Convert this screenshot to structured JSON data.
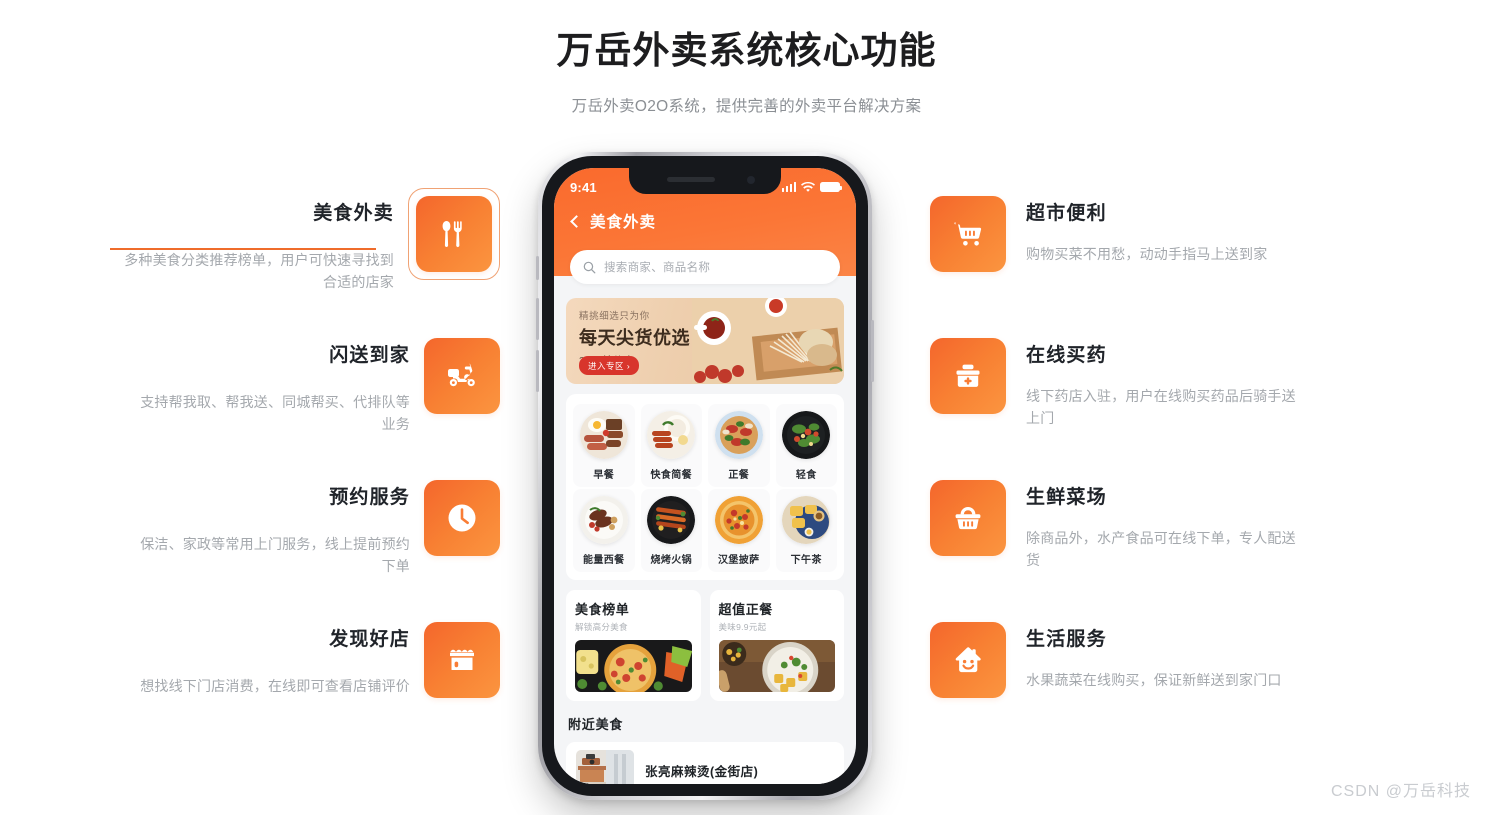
{
  "header": {
    "title": "万岳外卖系统核心功能",
    "subtitle": "万岳外卖O2O系统，提供完善的外卖平台解决方案"
  },
  "theme": {
    "accent": "#f4662c",
    "accent_light": "#fb9540",
    "active_rule": "#ef6c2b",
    "text_dark": "#20242a",
    "text_muted": "#a4a8ad"
  },
  "features_left": [
    {
      "title": "美食外卖",
      "desc": "多种美食分类推荐榜单，用户可快速寻找到合适的店家",
      "icon": "fork-spoon-icon",
      "active": true
    },
    {
      "title": "闪送到家",
      "desc": "支持帮我取、帮我送、同城帮买、代排队等业务",
      "icon": "scooter-icon",
      "active": false
    },
    {
      "title": "预约服务",
      "desc": "保洁、家政等常用上门服务，线上提前预约下单",
      "icon": "clock-icon",
      "active": false
    },
    {
      "title": "发现好店",
      "desc": "想找线下门店消费，在线即可查看店铺评价",
      "icon": "storefront-icon",
      "active": false
    }
  ],
  "features_right": [
    {
      "title": "超市便利",
      "desc": "购物买菜不用愁，动动手指马上送到家",
      "icon": "shopping-cart-icon",
      "active": false
    },
    {
      "title": "在线买药",
      "desc": "线下药店入驻，用户在线购买药品后骑手送上门",
      "icon": "medical-kit-icon",
      "active": false
    },
    {
      "title": "生鲜菜场",
      "desc": "除商品外，水产食品可在线下单，专人配送货",
      "icon": "shopping-basket-icon",
      "active": false
    },
    {
      "title": "生活服务",
      "desc": "水果蔬菜在线购买，保证新鲜送到家门口",
      "icon": "smiling-house-icon",
      "active": false
    }
  ],
  "phone": {
    "statusbar": {
      "time": "9:41",
      "signal_icon": "cellular-signal-icon",
      "wifi_icon": "wifi-icon",
      "battery_icon": "battery-full-icon"
    },
    "navbar": {
      "back_icon": "back-chevron-icon",
      "title": "美食外卖"
    },
    "search": {
      "icon": "search-icon",
      "placeholder": "搜索商家、商品名称"
    },
    "banner": {
      "eyebrow": "精挑细选只为你",
      "headline": "每天尖货优选",
      "subline": "35元特价中",
      "cta": "进入专区 ›"
    },
    "categories": [
      {
        "label": "早餐"
      },
      {
        "label": "快食简餐"
      },
      {
        "label": "正餐"
      },
      {
        "label": "轻食"
      },
      {
        "label": "能量西餐"
      },
      {
        "label": "烧烤火锅"
      },
      {
        "label": "汉堡披萨"
      },
      {
        "label": "下午茶"
      }
    ],
    "promos": [
      {
        "title": "美食榜单",
        "subtitle": "解锁高分美食"
      },
      {
        "title": "超值正餐",
        "subtitle": "美味9.9元起"
      }
    ],
    "nearby": {
      "section_title": "附近美食",
      "items": [
        {
          "name": "张亮麻辣烫(金街店)"
        }
      ]
    }
  },
  "watermark": "CSDN @万岳科技"
}
